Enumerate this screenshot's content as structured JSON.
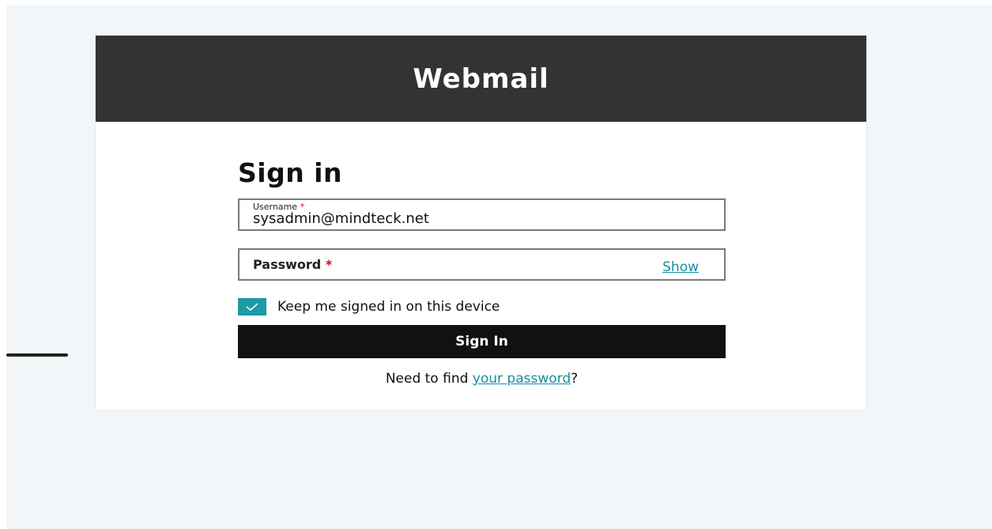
{
  "header": {
    "title": "Webmail"
  },
  "form": {
    "heading": "Sign in",
    "username": {
      "label": "Username",
      "required_mark": "*",
      "value": "sysadmin@mindteck.net"
    },
    "password": {
      "label": "Password",
      "required_mark": "*",
      "show_label": "Show"
    },
    "keep_signed_in": {
      "label": "Keep me signed in on this device",
      "checked": true
    },
    "submit_label": "Sign In",
    "help": {
      "prefix": "Need to find ",
      "link_text": "your password",
      "suffix": "?"
    }
  },
  "colors": {
    "header_bg": "#333333",
    "accent": "#1c9aa6",
    "link": "#138fa1",
    "button_bg": "#111111",
    "page_bg": "#f3f6f9",
    "required": "#d0021b"
  }
}
